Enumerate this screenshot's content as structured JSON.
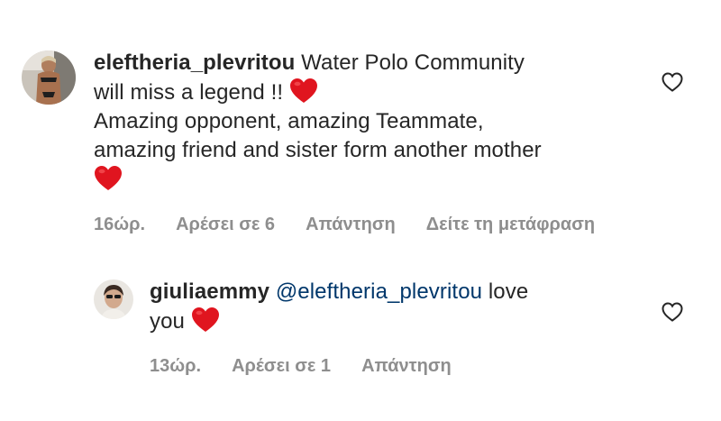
{
  "comments": [
    {
      "username": "eleftheria_plevritou",
      "line1_text": " Water Polo Community",
      "line2_text": "will miss a legend !! ",
      "line3_text": "Amazing opponent, amazing  Teammate,",
      "line4_text": "amazing friend and sister form another mother",
      "time": "16ώρ.",
      "likes": "Αρέσει σε 6",
      "reply": "Απάντηση",
      "translate": "Δείτε τη μετάφραση",
      "like_icon": "heart-outline-icon"
    },
    {
      "username": "giuliaemmy",
      "mention": "@eleftheria_plevritou",
      "line1_text": " love",
      "line2_text": "you ",
      "time": "13ώρ.",
      "likes": "Αρέσει σε 1",
      "reply": "Απάντηση",
      "like_icon": "heart-outline-icon"
    }
  ],
  "colors": {
    "text": "#262626",
    "secondary": "#8e8e8e",
    "mention": "#00376b",
    "emoji_heart": "#e0151f"
  }
}
